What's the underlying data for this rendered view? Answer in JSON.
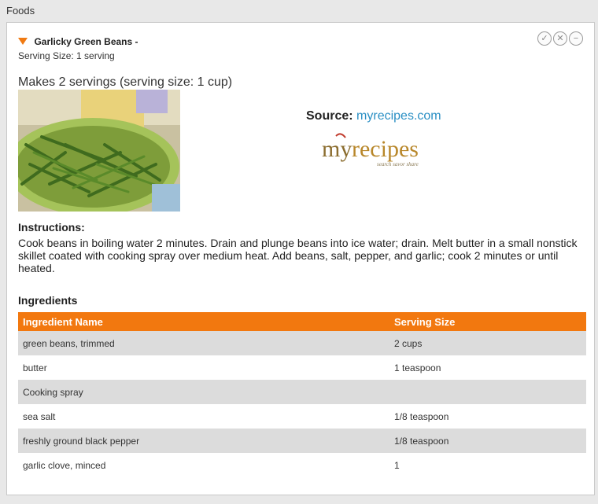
{
  "frame": {
    "title": "Foods"
  },
  "food": {
    "name": "Garlicky Green Beans -",
    "serving_line": "Serving Size: 1 serving",
    "controls": [
      {
        "name": "confirm-icon",
        "glyph": "✓"
      },
      {
        "name": "delete-icon",
        "glyph": "✕"
      },
      {
        "name": "minimize-icon",
        "glyph": "−"
      }
    ]
  },
  "recipe": {
    "makes": "Makes 2 servings (serving size: 1 cup)",
    "source_label": "Source:",
    "source_link": "myrecipes.com",
    "logo_text": "myrecipes",
    "logo_tagline": "search savor share",
    "instructions_title": "Instructions:",
    "instructions": "Cook beans in boiling water 2 minutes. Drain and plunge beans into ice water; drain. Melt butter in a small nonstick skillet coated with cooking spray over medium heat. Add beans, salt, pepper, and garlic; cook 2 minutes or until heated.",
    "ingredients_title": "Ingredients"
  },
  "ingredients_table": {
    "headers": [
      "Ingredient Name",
      "Serving Size"
    ],
    "rows": [
      {
        "name": "green beans, trimmed",
        "size": "2 cups"
      },
      {
        "name": "butter",
        "size": "1 teaspoon"
      },
      {
        "name": "Cooking spray",
        "size": ""
      },
      {
        "name": "sea salt",
        "size": "1/8 teaspoon"
      },
      {
        "name": "freshly ground black pepper",
        "size": "1/8 teaspoon"
      },
      {
        "name": "garlic clove, minced",
        "size": "1"
      }
    ]
  },
  "colors": {
    "accent_orange": "#f2780f",
    "link_blue": "#2a8fc4",
    "row_alt": "#dcdcdc"
  }
}
